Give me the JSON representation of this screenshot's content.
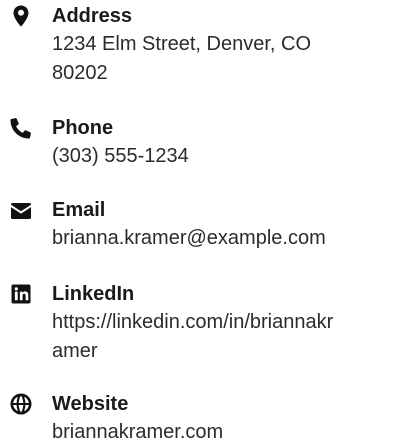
{
  "contacts": {
    "address": {
      "label": "Address",
      "value_line1": "1234 Elm Street, Denver, CO",
      "value_line2": "80202",
      "icon": "map-pin-icon"
    },
    "phone": {
      "label": "Phone",
      "value": "(303) 555-1234",
      "icon": "phone-icon"
    },
    "email": {
      "label": "Email",
      "value": "brianna.kramer@example.com",
      "icon": "envelope-icon"
    },
    "linkedin": {
      "label": "LinkedIn",
      "value_line1": "https://linkedin.com/in/briannakr",
      "value_line2": "amer",
      "icon": "linkedin-icon"
    },
    "website": {
      "label": "Website",
      "value": "briannakramer.com",
      "icon": "globe-icon"
    }
  },
  "colors": {
    "text": "#1f1f1f",
    "icon": "#111111",
    "background": "#ffffff"
  }
}
